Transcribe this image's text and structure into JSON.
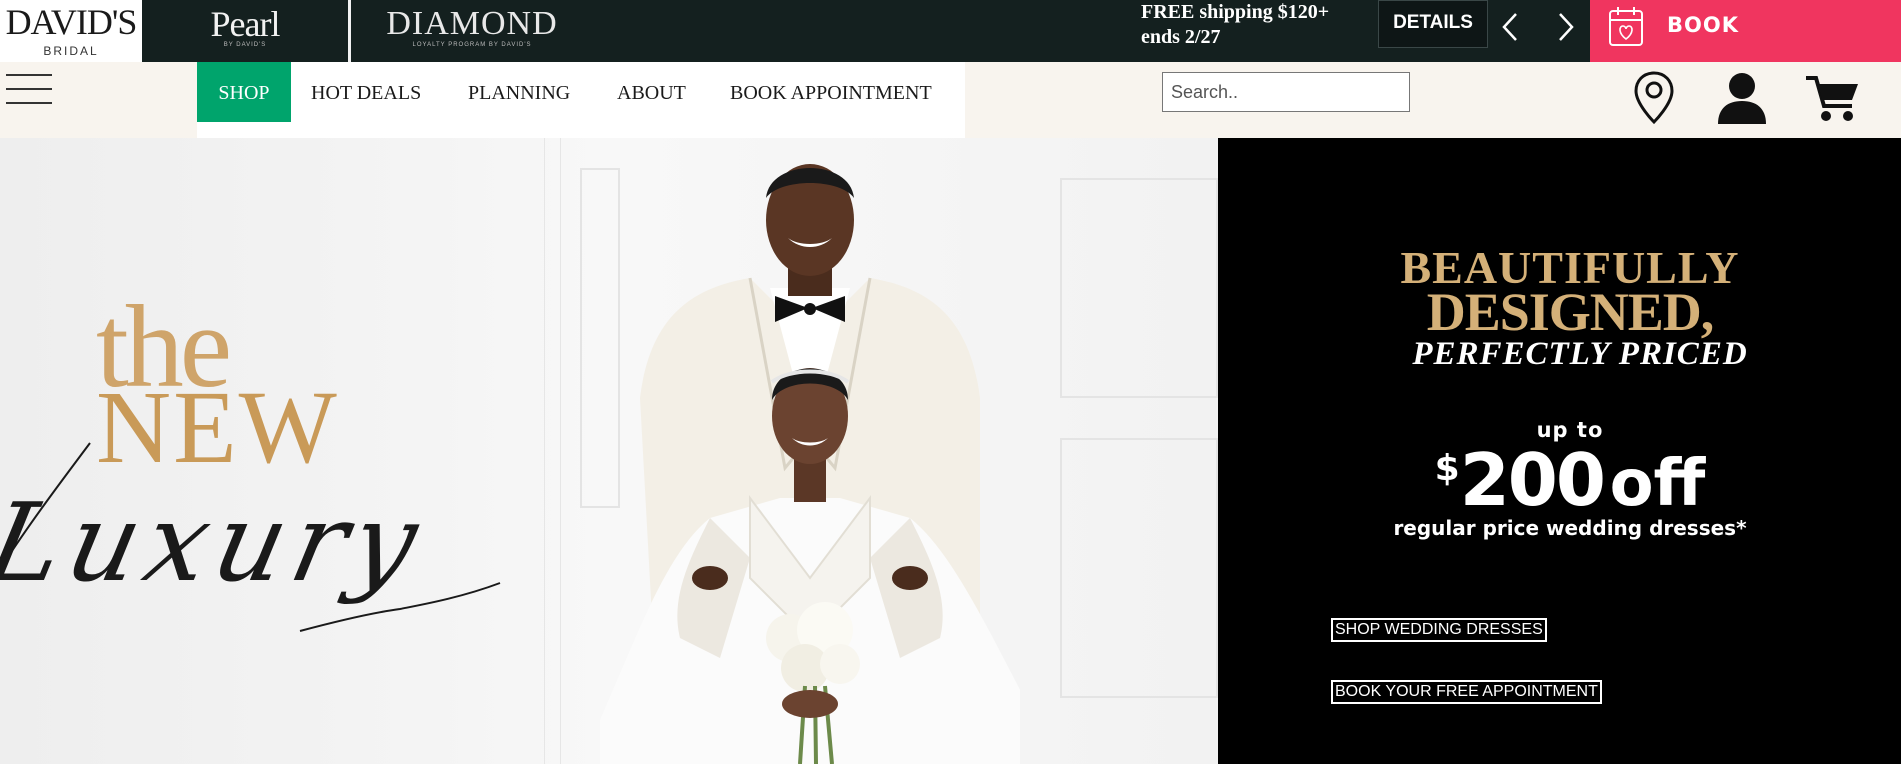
{
  "topbar": {
    "logo_main": "DAVID'S",
    "logo_sub": "BRIDAL",
    "pearl_main": "Pearl",
    "pearl_sub": "BY DAVID'S",
    "diamond_main": "DIAMOND",
    "diamond_sub": "LOYALTY PROGRAM BY DAVID'S",
    "promo_line1": "FREE shipping $120+",
    "promo_line2": "ends 2/27",
    "details_label": "DETAILS",
    "book_label": "BOOK APPOINTMENT",
    "book_bg": "#f0355f",
    "bar_bg": "#14201f"
  },
  "nav": {
    "items": [
      {
        "label": "SHOP",
        "active": true
      },
      {
        "label": "HOT DEALS"
      },
      {
        "label": "PLANNING"
      },
      {
        "label": "ABOUT"
      },
      {
        "label": "BOOK APPOINTMENT"
      }
    ],
    "active_color": "#00a46c",
    "search_placeholder": "Search.."
  },
  "hero": {
    "script_the": "the",
    "script_new": "NEW",
    "script_luxury": "Luxury",
    "gold_color": "#c99a58",
    "headline_1": "BEAUTIFULLY",
    "headline_2": "DESIGNED,",
    "subheadline": "PERFECTLY PRICED",
    "up_to": "up to",
    "dollar": "$",
    "amount": "200",
    "off": "off",
    "regular": "regular price wedding dresses*",
    "link_shop": "SHOP WEDDING DRESSES",
    "link_book": "BOOK YOUR FREE APPOINTMENT"
  }
}
